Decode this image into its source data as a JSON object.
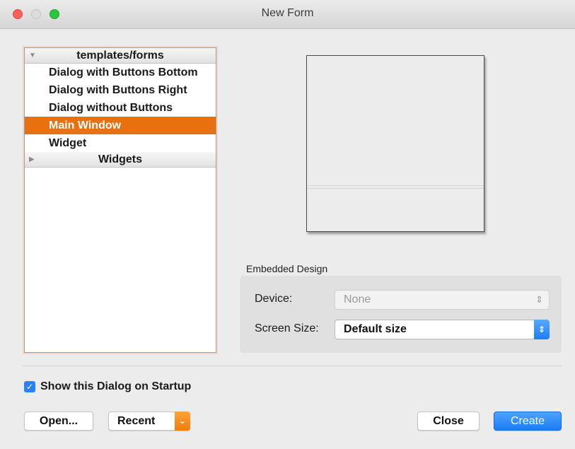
{
  "window": {
    "title": "New Form",
    "controls": [
      "close",
      "minimize",
      "zoom"
    ]
  },
  "tree": {
    "groups": [
      {
        "label": "templates/forms",
        "expanded": true,
        "items": [
          {
            "label": "Dialog with Buttons Bottom",
            "selected": false
          },
          {
            "label": "Dialog with Buttons Right",
            "selected": false
          },
          {
            "label": "Dialog without Buttons",
            "selected": false
          },
          {
            "label": "Main Window",
            "selected": true
          },
          {
            "label": "Widget",
            "selected": false
          }
        ]
      },
      {
        "label": "Widgets",
        "expanded": false,
        "items": []
      }
    ],
    "selection_color": "#e8700e"
  },
  "embedded_design": {
    "label": "Embedded Design",
    "device": {
      "label": "Device:",
      "value": "None",
      "enabled": false
    },
    "screen_size": {
      "label": "Screen Size:",
      "value": "Default size",
      "enabled": true
    }
  },
  "startup_checkbox": {
    "label": "Show this Dialog on Startup",
    "checked": true
  },
  "buttons": {
    "open": "Open...",
    "recent": "Recent",
    "close": "Close",
    "create": "Create"
  },
  "colors": {
    "accent_blue": "#1a7cf3",
    "accent_orange": "#ee7d0c"
  }
}
